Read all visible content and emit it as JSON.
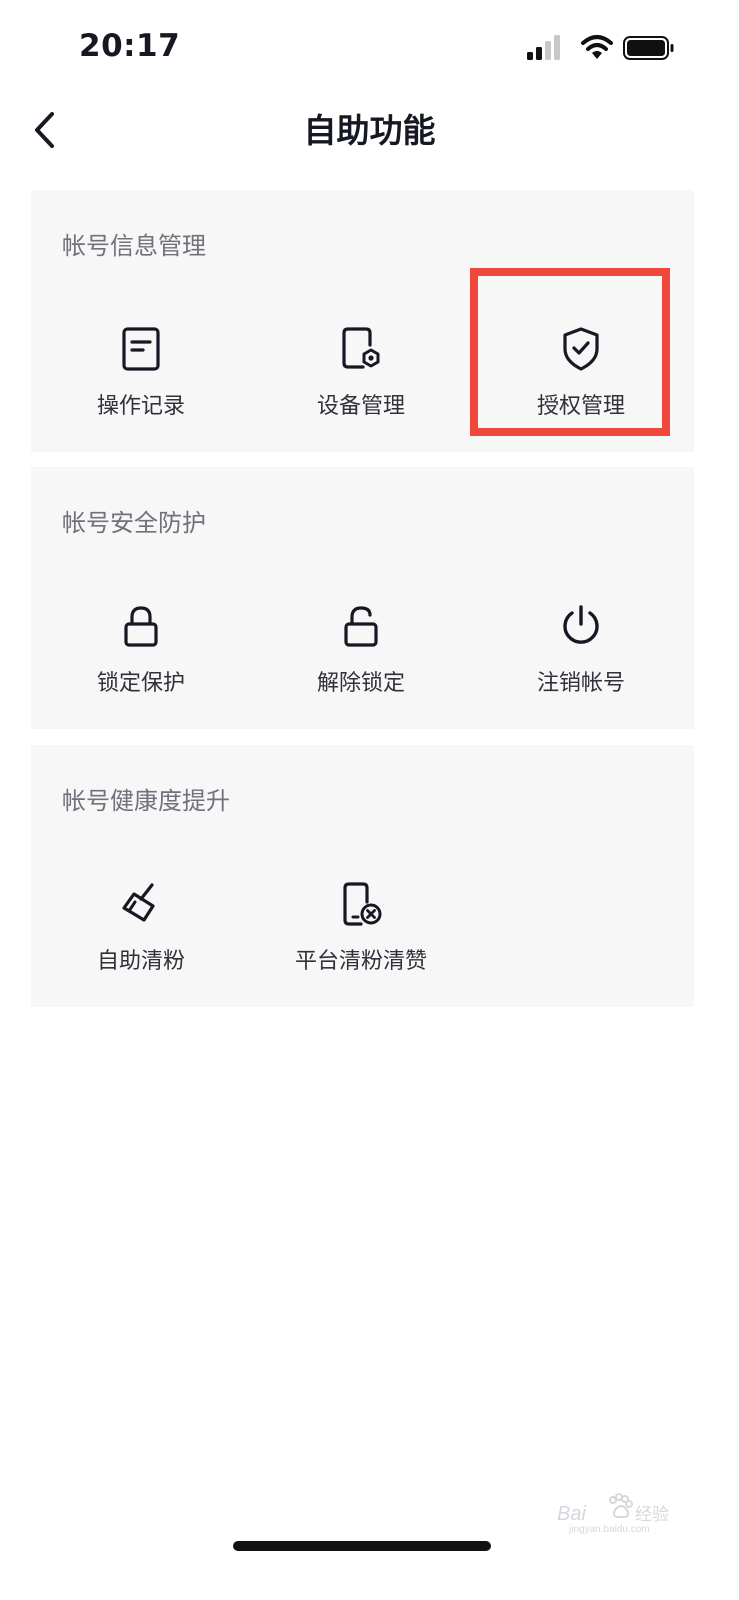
{
  "status_bar": {
    "time": "20:17",
    "icons": [
      "signal-icon",
      "wifi-icon",
      "battery-icon"
    ]
  },
  "nav": {
    "back_icon": "chevron-left-icon",
    "title": "自助功能"
  },
  "sections": [
    {
      "title": "帐号信息管理",
      "items": [
        {
          "label": "操作记录",
          "icon": "document-icon"
        },
        {
          "label": "设备管理",
          "icon": "device-settings-icon"
        },
        {
          "label": "授权管理",
          "icon": "shield-check-icon",
          "highlighted": true
        }
      ]
    },
    {
      "title": "帐号安全防护",
      "items": [
        {
          "label": "锁定保护",
          "icon": "lock-icon"
        },
        {
          "label": "解除锁定",
          "icon": "unlock-icon"
        },
        {
          "label": "注销帐号",
          "icon": "power-icon"
        }
      ]
    },
    {
      "title": "帐号健康度提升",
      "items": [
        {
          "label": "自助清粉",
          "icon": "brush-icon"
        },
        {
          "label": "平台清粉清赞",
          "icon": "phone-remove-icon"
        }
      ]
    }
  ],
  "colors": {
    "card_background": "#f7f7f8",
    "highlight_border": "#f0473d",
    "text_primary": "#161823",
    "text_secondary": "#70717a"
  }
}
